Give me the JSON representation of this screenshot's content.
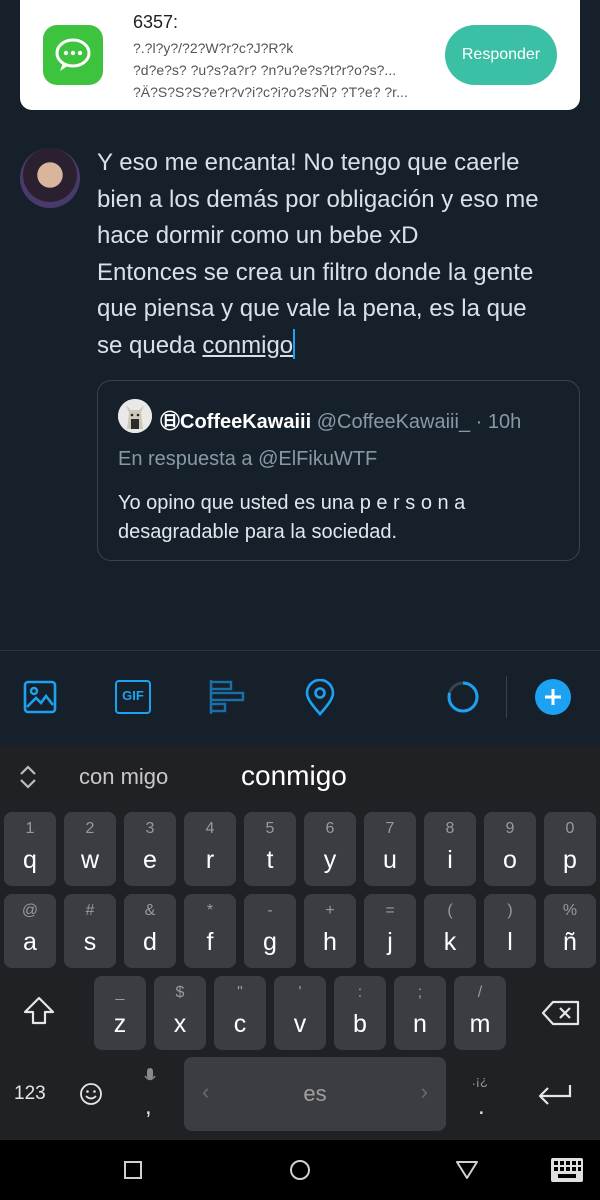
{
  "notification": {
    "app_icon": "messages-icon",
    "title": "6357:",
    "lines": [
      "?.?l?y?/?2?W?r?c?J?R?k",
      "?d?e?s? ?u?s?a?r? ?n?u?e?s?t?r?o?s?...",
      "?Ä?S?S?S?e?r?v?i?c?i?o?s?Ñ? ?T?e? ?r..."
    ],
    "reply_label": "Responder"
  },
  "compose": {
    "line1": "Y eso me encanta! No tengo que caerle",
    "line2": "bien a los demás por obligación y eso me",
    "line3": "hace dormir como un bebe xD",
    "line4": "Entonces se crea un filtro donde la gente",
    "line5": "que piensa y que vale la pena, es la que",
    "line6_prefix": "se queda ",
    "line6_word": "conmigo"
  },
  "quote": {
    "name": "㊐CoffeeKawaiii",
    "handle": "@CoffeeKawaiii_ · 10h",
    "reply_to": "En respuesta a @ElFikuWTF",
    "text": "Yo opino que usted es una p e r s o n a desagradable para la sociedad."
  },
  "toolbar": {
    "icons": [
      "image-icon",
      "gif-icon",
      "poll-icon",
      "location-icon",
      "progress-ring-icon",
      "add-tweet-icon"
    ],
    "gif_label": "GIF",
    "accent": "#1da1f2"
  },
  "keyboard": {
    "suggestions": [
      "con migo",
      "conmigo"
    ],
    "row1": [
      {
        "hint": "1",
        "key": "q"
      },
      {
        "hint": "2",
        "key": "w"
      },
      {
        "hint": "3",
        "key": "e"
      },
      {
        "hint": "4",
        "key": "r"
      },
      {
        "hint": "5",
        "key": "t"
      },
      {
        "hint": "6",
        "key": "y"
      },
      {
        "hint": "7",
        "key": "u"
      },
      {
        "hint": "8",
        "key": "i"
      },
      {
        "hint": "9",
        "key": "o"
      },
      {
        "hint": "0",
        "key": "p"
      }
    ],
    "row2": [
      {
        "hint": "@",
        "key": "a"
      },
      {
        "hint": "#",
        "key": "s"
      },
      {
        "hint": "&",
        "key": "d"
      },
      {
        "hint": "*",
        "key": "f"
      },
      {
        "hint": "-",
        "key": "g"
      },
      {
        "hint": "+",
        "key": "h"
      },
      {
        "hint": "=",
        "key": "j"
      },
      {
        "hint": "(",
        "key": "k"
      },
      {
        "hint": ")",
        "key": "l"
      },
      {
        "hint": "%",
        "key": "ñ"
      }
    ],
    "row3": [
      {
        "hint": "_",
        "key": "z"
      },
      {
        "hint": "$",
        "key": "x"
      },
      {
        "hint": "\"",
        "key": "c"
      },
      {
        "hint": "'",
        "key": "v"
      },
      {
        "hint": ":",
        "key": "b"
      },
      {
        "hint": ";",
        "key": "n"
      },
      {
        "hint": "/",
        "key": "m"
      }
    ],
    "numbers_label": "123",
    "emoji_icon": "emoji-icon",
    "comma_key": ",",
    "space_label": "es",
    "period_hint": ".¡¿",
    "period_key": ".",
    "shift_icon": "shift-icon",
    "backspace_icon": "backspace-icon",
    "enter_icon": "enter-icon"
  },
  "navbar": {
    "icons": [
      "recent-apps-icon",
      "home-icon",
      "back-icon",
      "keyboard-switch-icon"
    ]
  }
}
